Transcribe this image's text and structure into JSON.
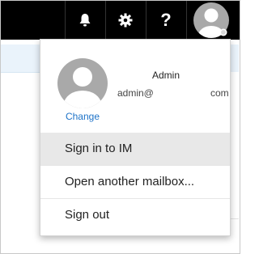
{
  "topbar": {
    "icons": [
      "bell-icon",
      "gear-icon",
      "question-icon",
      "user-avatar-icon"
    ],
    "help_label": "?"
  },
  "profile": {
    "name": "Admin",
    "email_part1": "admin@",
    "email_part2": "com",
    "change_label": "Change"
  },
  "menu": {
    "items": [
      {
        "label": "Sign in to IM",
        "highlighted": true
      },
      {
        "label": "Open another mailbox...",
        "highlighted": false
      },
      {
        "label": "Sign out",
        "highlighted": false
      }
    ]
  },
  "colors": {
    "topbar_bg": "#000000",
    "link": "#1e73c8",
    "highlight": "#e8e8e8"
  }
}
